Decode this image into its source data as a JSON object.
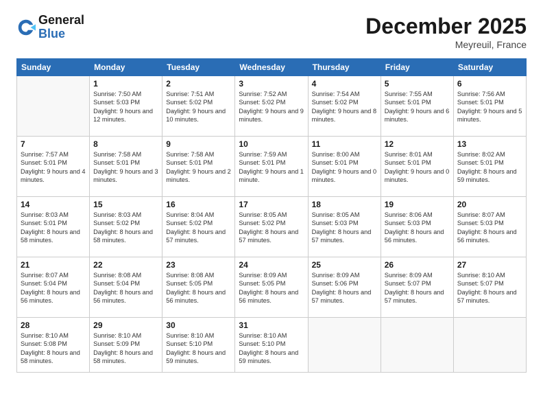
{
  "header": {
    "logo_general": "General",
    "logo_blue": "Blue",
    "title": "December 2025",
    "location": "Meyreuil, France"
  },
  "days_of_week": [
    "Sunday",
    "Monday",
    "Tuesday",
    "Wednesday",
    "Thursday",
    "Friday",
    "Saturday"
  ],
  "weeks": [
    [
      {
        "day": "",
        "info": ""
      },
      {
        "day": "1",
        "info": "Sunrise: 7:50 AM\nSunset: 5:03 PM\nDaylight: 9 hours\nand 12 minutes."
      },
      {
        "day": "2",
        "info": "Sunrise: 7:51 AM\nSunset: 5:02 PM\nDaylight: 9 hours\nand 10 minutes."
      },
      {
        "day": "3",
        "info": "Sunrise: 7:52 AM\nSunset: 5:02 PM\nDaylight: 9 hours\nand 9 minutes."
      },
      {
        "day": "4",
        "info": "Sunrise: 7:54 AM\nSunset: 5:02 PM\nDaylight: 9 hours\nand 8 minutes."
      },
      {
        "day": "5",
        "info": "Sunrise: 7:55 AM\nSunset: 5:01 PM\nDaylight: 9 hours\nand 6 minutes."
      },
      {
        "day": "6",
        "info": "Sunrise: 7:56 AM\nSunset: 5:01 PM\nDaylight: 9 hours\nand 5 minutes."
      }
    ],
    [
      {
        "day": "7",
        "info": "Sunrise: 7:57 AM\nSunset: 5:01 PM\nDaylight: 9 hours\nand 4 minutes."
      },
      {
        "day": "8",
        "info": "Sunrise: 7:58 AM\nSunset: 5:01 PM\nDaylight: 9 hours\nand 3 minutes."
      },
      {
        "day": "9",
        "info": "Sunrise: 7:58 AM\nSunset: 5:01 PM\nDaylight: 9 hours\nand 2 minutes."
      },
      {
        "day": "10",
        "info": "Sunrise: 7:59 AM\nSunset: 5:01 PM\nDaylight: 9 hours\nand 1 minute."
      },
      {
        "day": "11",
        "info": "Sunrise: 8:00 AM\nSunset: 5:01 PM\nDaylight: 9 hours\nand 0 minutes."
      },
      {
        "day": "12",
        "info": "Sunrise: 8:01 AM\nSunset: 5:01 PM\nDaylight: 9 hours\nand 0 minutes."
      },
      {
        "day": "13",
        "info": "Sunrise: 8:02 AM\nSunset: 5:01 PM\nDaylight: 8 hours\nand 59 minutes."
      }
    ],
    [
      {
        "day": "14",
        "info": "Sunrise: 8:03 AM\nSunset: 5:01 PM\nDaylight: 8 hours\nand 58 minutes."
      },
      {
        "day": "15",
        "info": "Sunrise: 8:03 AM\nSunset: 5:02 PM\nDaylight: 8 hours\nand 58 minutes."
      },
      {
        "day": "16",
        "info": "Sunrise: 8:04 AM\nSunset: 5:02 PM\nDaylight: 8 hours\nand 57 minutes."
      },
      {
        "day": "17",
        "info": "Sunrise: 8:05 AM\nSunset: 5:02 PM\nDaylight: 8 hours\nand 57 minutes."
      },
      {
        "day": "18",
        "info": "Sunrise: 8:05 AM\nSunset: 5:03 PM\nDaylight: 8 hours\nand 57 minutes."
      },
      {
        "day": "19",
        "info": "Sunrise: 8:06 AM\nSunset: 5:03 PM\nDaylight: 8 hours\nand 56 minutes."
      },
      {
        "day": "20",
        "info": "Sunrise: 8:07 AM\nSunset: 5:03 PM\nDaylight: 8 hours\nand 56 minutes."
      }
    ],
    [
      {
        "day": "21",
        "info": "Sunrise: 8:07 AM\nSunset: 5:04 PM\nDaylight: 8 hours\nand 56 minutes."
      },
      {
        "day": "22",
        "info": "Sunrise: 8:08 AM\nSunset: 5:04 PM\nDaylight: 8 hours\nand 56 minutes."
      },
      {
        "day": "23",
        "info": "Sunrise: 8:08 AM\nSunset: 5:05 PM\nDaylight: 8 hours\nand 56 minutes."
      },
      {
        "day": "24",
        "info": "Sunrise: 8:09 AM\nSunset: 5:05 PM\nDaylight: 8 hours\nand 56 minutes."
      },
      {
        "day": "25",
        "info": "Sunrise: 8:09 AM\nSunset: 5:06 PM\nDaylight: 8 hours\nand 57 minutes."
      },
      {
        "day": "26",
        "info": "Sunrise: 8:09 AM\nSunset: 5:07 PM\nDaylight: 8 hours\nand 57 minutes."
      },
      {
        "day": "27",
        "info": "Sunrise: 8:10 AM\nSunset: 5:07 PM\nDaylight: 8 hours\nand 57 minutes."
      }
    ],
    [
      {
        "day": "28",
        "info": "Sunrise: 8:10 AM\nSunset: 5:08 PM\nDaylight: 8 hours\nand 58 minutes."
      },
      {
        "day": "29",
        "info": "Sunrise: 8:10 AM\nSunset: 5:09 PM\nDaylight: 8 hours\nand 58 minutes."
      },
      {
        "day": "30",
        "info": "Sunrise: 8:10 AM\nSunset: 5:10 PM\nDaylight: 8 hours\nand 59 minutes."
      },
      {
        "day": "31",
        "info": "Sunrise: 8:10 AM\nSunset: 5:10 PM\nDaylight: 8 hours\nand 59 minutes."
      },
      {
        "day": "",
        "info": ""
      },
      {
        "day": "",
        "info": ""
      },
      {
        "day": "",
        "info": ""
      }
    ]
  ]
}
